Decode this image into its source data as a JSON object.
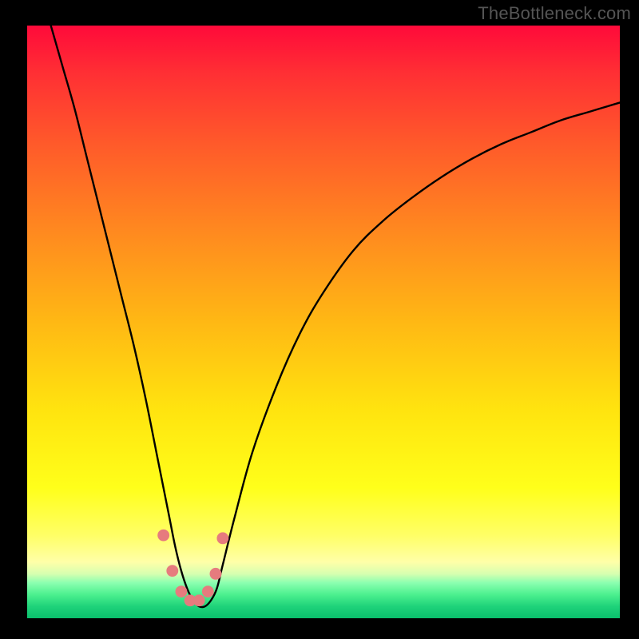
{
  "watermark": "TheBottleneck.com",
  "chart_data": {
    "type": "line",
    "title": "",
    "xlabel": "",
    "ylabel": "",
    "xlim": [
      0,
      100
    ],
    "ylim": [
      0,
      100
    ],
    "series": [
      {
        "name": "curve",
        "x": [
          4,
          6,
          8,
          10,
          12,
          14,
          16,
          18,
          20,
          22,
          23,
          24,
          25,
          26,
          27,
          28,
          29,
          30,
          31,
          32,
          33,
          35,
          38,
          42,
          46,
          50,
          55,
          60,
          65,
          70,
          75,
          80,
          85,
          90,
          95,
          100
        ],
        "y": [
          100,
          93,
          86,
          78,
          70,
          62,
          54,
          46,
          37,
          27,
          22,
          17,
          12,
          8,
          5,
          3,
          2,
          2,
          3,
          5,
          9,
          17,
          28,
          39,
          48,
          55,
          62,
          67,
          71,
          74.5,
          77.5,
          80,
          82,
          84,
          85.5,
          87
        ]
      }
    ],
    "markers": {
      "color": "#e67b7e",
      "radius_norm": 1.0,
      "points": [
        {
          "x": 23.0,
          "y": 14.0
        },
        {
          "x": 24.5,
          "y": 8.0
        },
        {
          "x": 26.0,
          "y": 4.5
        },
        {
          "x": 27.5,
          "y": 3.0
        },
        {
          "x": 29.0,
          "y": 3.0
        },
        {
          "x": 30.5,
          "y": 4.5
        },
        {
          "x": 31.8,
          "y": 7.5
        },
        {
          "x": 33.0,
          "y": 13.5
        }
      ]
    }
  }
}
